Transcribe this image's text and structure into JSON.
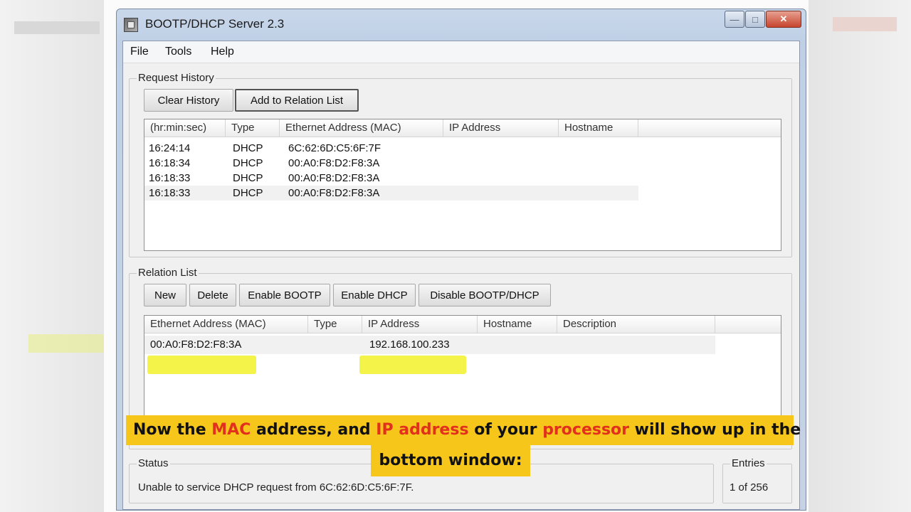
{
  "window": {
    "title": "BOOTP/DHCP Server 2.3",
    "minimize": "—",
    "maximize": "□",
    "close": "✕"
  },
  "menu": [
    "File",
    "Tools",
    "Help"
  ],
  "request_history": {
    "label": "Request History",
    "buttons": {
      "clear": "Clear History",
      "add": "Add to Relation List"
    },
    "columns": [
      "(hr:min:sec)",
      "Type",
      "Ethernet Address (MAC)",
      "IP Address",
      "Hostname"
    ],
    "rows": [
      {
        "time": "16:24:14",
        "type": "DHCP",
        "mac": "6C:62:6D:C5:6F:7F",
        "ip": "",
        "host": ""
      },
      {
        "time": "16:18:34",
        "type": "DHCP",
        "mac": "00:A0:F8:D2:F8:3A",
        "ip": "",
        "host": ""
      },
      {
        "time": "16:18:33",
        "type": "DHCP",
        "mac": "00:A0:F8:D2:F8:3A",
        "ip": "",
        "host": ""
      },
      {
        "time": "16:18:33",
        "type": "DHCP",
        "mac": "00:A0:F8:D2:F8:3A",
        "ip": "",
        "host": ""
      }
    ]
  },
  "relation_list": {
    "label": "Relation List",
    "buttons": {
      "new": "New",
      "delete": "Delete",
      "enable_bootp": "Enable BOOTP",
      "enable_dhcp": "Enable DHCP",
      "disable": "Disable BOOTP/DHCP"
    },
    "columns": [
      "Ethernet Address (MAC)",
      "Type",
      "IP Address",
      "Hostname",
      "Description"
    ],
    "rows": [
      {
        "mac": "00:A0:F8:D2:F8:3A",
        "type": "",
        "ip": "192.168.100.233",
        "host": "",
        "desc": ""
      }
    ]
  },
  "status": {
    "label": "Status",
    "text": "Unable to service DHCP request from 6C:62:6D:C5:6F:7F."
  },
  "entries": {
    "label": "Entries",
    "value": "1 of 256"
  },
  "caption": {
    "line1_a": "Now the ",
    "line1_b": "MAC",
    "line1_c": " address, and ",
    "line1_d": "IP address",
    "line1_e": " of your ",
    "line1_f": "processor",
    "line1_g": " will show up in the",
    "line2": "bottom window:"
  },
  "colors": {
    "highlight": "#f3f34a",
    "caption_bg": "#f6c61a",
    "caption_accent": "#e2301c"
  }
}
